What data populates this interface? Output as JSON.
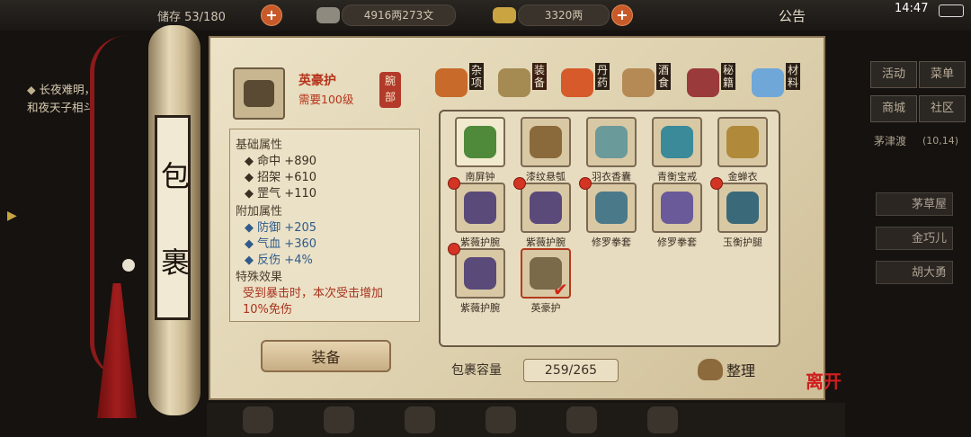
{
  "topbar": {
    "bag_text": "储存 53/180",
    "silver_text": "4916两273文",
    "gold_text": "3320两",
    "notice": "公告",
    "time": "14:47"
  },
  "story": {
    "line1": "长夜难明，",
    "line2": "和夜天子相斗"
  },
  "right_panel": {
    "buttons": [
      "活动",
      "菜单",
      "商城",
      "社区"
    ],
    "location": "茅津渡",
    "coords": "(10,14)",
    "npcs": [
      "茅草屋",
      "金巧儿",
      "胡大勇"
    ]
  },
  "scroll_title": [
    "包",
    "裹"
  ],
  "selected_item": {
    "name": "英豪护",
    "requirement": "需要100级",
    "slot_tag": "腕部",
    "base_title": "基础属性",
    "base_stats": [
      {
        "name": "命中",
        "value": "+890"
      },
      {
        "name": "招架",
        "value": "+610"
      },
      {
        "name": "罡气",
        "value": "+110"
      }
    ],
    "extra_title": "附加属性",
    "extra_stats": [
      {
        "name": "防御",
        "value": "+205"
      },
      {
        "name": "气血",
        "value": "+360"
      },
      {
        "name": "反伤",
        "value": "+4%"
      }
    ],
    "special_title": "特殊效果",
    "special_line1": "受到暴击时，本次受击增加",
    "special_line2": "10%免伤"
  },
  "equip_button": "装备",
  "tabs": [
    {
      "label": "杂项",
      "color": "#c76a2a"
    },
    {
      "label": "装备",
      "color": "#a58a52"
    },
    {
      "label": "丹药",
      "color": "#d65a2a"
    },
    {
      "label": "酒食",
      "color": "#b58a55"
    },
    {
      "label": "秘籍",
      "color": "#9a3a3a"
    },
    {
      "label": "材料",
      "color": "#6fa8d8"
    }
  ],
  "items": [
    {
      "name": "南屏钟",
      "color": "#4e8a3a"
    },
    {
      "name": "漆纹悬瓠",
      "color": "#8a6a3a"
    },
    {
      "name": "羽衣香囊",
      "color": "#6a9a9a"
    },
    {
      "name": "青衡宝戒",
      "color": "#3a8a9a"
    },
    {
      "name": "金蝉衣",
      "color": "#b08a3a"
    },
    {
      "name": "紫薇护腕",
      "color": "#5a4a7a"
    },
    {
      "name": "紫薇护腕",
      "color": "#5a4a7a"
    },
    {
      "name": "修罗拳套",
      "color": "#4a7a8a"
    },
    {
      "name": "修罗拳套",
      "color": "#6a5a9a"
    },
    {
      "name": "玉衡护腿",
      "color": "#3a6a7a"
    },
    {
      "name": "紫薇护腕",
      "color": "#5a4a7a"
    },
    {
      "name": "英豪护",
      "color": "#7a6a4a"
    }
  ],
  "capacity_label": "包裹容量",
  "capacity_value": "259/265",
  "sort_label": "整理",
  "leave_label": "离开"
}
